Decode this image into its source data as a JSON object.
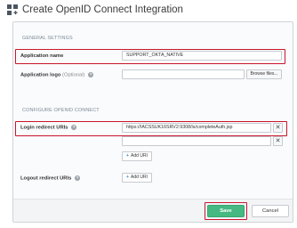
{
  "window": {
    "title": "Create OpenID Connect Integration",
    "icon": "integration-grid-icon"
  },
  "general_settings": {
    "section_title": "GENERAL SETTINGS",
    "app_name_label": "Application name",
    "app_name_value": "SUPPORT_OKTA_NATIVE",
    "app_logo_label": "Application logo",
    "app_logo_optional": "(Optional)",
    "app_logo_value": "",
    "browse_label": "Browse files..."
  },
  "configure_openid": {
    "section_title": "CONFIGURE OPENID CONNECT",
    "login_redirect_label": "Login redirect URIs",
    "login_redirect_uris": [
      "https://IACSSUK16SRV2:9308/ls/completeAuth.jsp",
      ""
    ],
    "add_uri_label": "Add URI",
    "logout_redirect_label": "Logout redirect URIs",
    "logout_add_uri_label": "Add URI"
  },
  "footer": {
    "save_label": "Save",
    "cancel_label": "Cancel"
  },
  "colors": {
    "highlight": "#c9152c",
    "save_button": "#46b882",
    "section_title": "#7a8a99"
  }
}
